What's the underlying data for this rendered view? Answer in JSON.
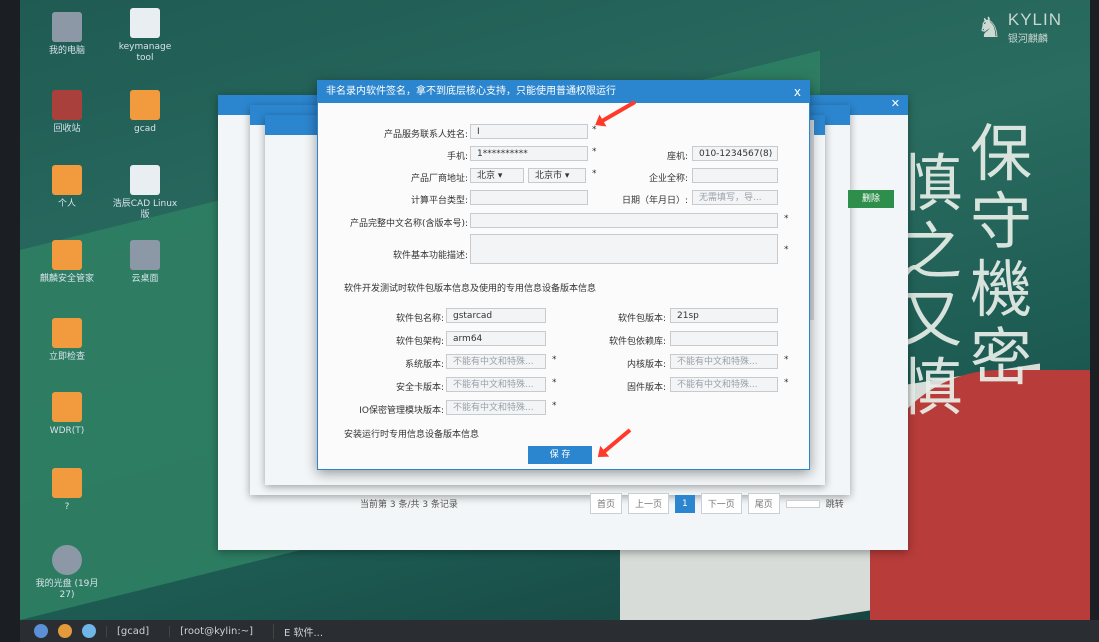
{
  "desktop": {
    "icons": [
      {
        "label": "我的电脑"
      },
      {
        "label": "keymanage tool"
      },
      {
        "label": "回收站"
      },
      {
        "label": "gcad"
      },
      {
        "label": "个人"
      },
      {
        "label": "浩辰CAD Linux版"
      },
      {
        "label": "麒麟安全管家"
      },
      {
        "label": "云桌面"
      },
      {
        "label": "立即检查"
      },
      {
        "label": "WDR(T)"
      },
      {
        "label": "?"
      },
      {
        "label": "我的光盘 (19月27)"
      }
    ],
    "logo": {
      "brand": "KYLIN",
      "subtitle": "银河麒麟"
    },
    "calligraphy": [
      "保守機密",
      "慎之又慎"
    ]
  },
  "taskbar": {
    "items": [
      "[gcad]",
      "[root@kylin:~]",
      "E 软件..."
    ]
  },
  "back_window": {
    "delete_label": "删除",
    "pager": {
      "summary": "当前第 3 条/共 3 条记录",
      "first": "首页",
      "prev": "上一页",
      "current": "1",
      "next": "下一页",
      "last": "尾页",
      "jump": "跳转"
    }
  },
  "dialog": {
    "title": "非名录内软件签名，拿不到底层核心支持，只能使用普通权限运行",
    "close": "x",
    "fields": {
      "contact_name": {
        "label": "产品服务联系人姓名:",
        "value": "I"
      },
      "phone": {
        "label": "手机:",
        "value": "1**********"
      },
      "fax": {
        "label": "座机:",
        "value": "010-1234567(8)"
      },
      "address": {
        "label": "产品厂商地址:",
        "province": "北京",
        "city": "北京市"
      },
      "company": {
        "label": "企业全称:",
        "value": ""
      },
      "platform": {
        "label": "计算平台类型:",
        "value": ""
      },
      "date": {
        "label": "日期（年月日）:",
        "value": "无需填写，导..."
      },
      "full_name": {
        "label": "产品完整中文名称(含版本号):",
        "value": ""
      },
      "description": {
        "label": "软件基本功能描述:",
        "value": ""
      }
    },
    "section1": "软件开发测试时软件包版本信息及使用的专用信息设备版本信息",
    "pkg": {
      "name": {
        "label": "软件包名称:",
        "value": "gstarcad"
      },
      "version": {
        "label": "软件包版本:",
        "value": "21sp"
      },
      "arch": {
        "label": "软件包架构:",
        "value": "arm64"
      },
      "deps": {
        "label": "软件包依赖库:",
        "value": ""
      },
      "sys_version": {
        "label": "系统版本:",
        "placeholder": "不能有中文和特殊..."
      },
      "kernel_version": {
        "label": "内核版本:",
        "placeholder": "不能有中文和特殊..."
      },
      "safe_card": {
        "label": "安全卡版本:",
        "placeholder": "不能有中文和特殊..."
      },
      "firmware": {
        "label": "固件版本:",
        "placeholder": "不能有中文和特殊..."
      },
      "io_module": {
        "label": "IO保密管理模块版本:",
        "placeholder": "不能有中文和特殊..."
      }
    },
    "section2": "安装运行时专用信息设备版本信息",
    "save_label": "保 存",
    "required_mark": "*"
  },
  "colors": {
    "titlebar": "#2c86cf",
    "annotation_arrow": "#ff3a2a"
  }
}
